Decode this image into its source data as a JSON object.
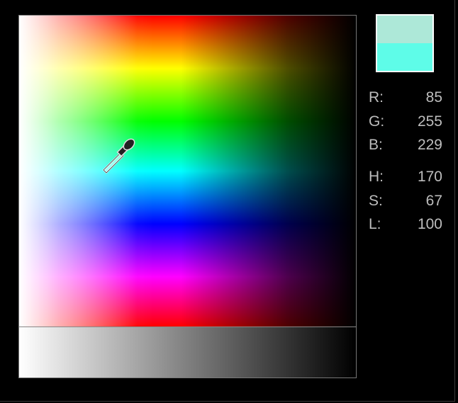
{
  "colors": {
    "previous": "#ade8d8",
    "current": "#5efce8"
  },
  "rgb": [
    {
      "label": "R:",
      "value": "85"
    },
    {
      "label": "G:",
      "value": "255"
    },
    {
      "label": "B:",
      "value": "229"
    }
  ],
  "hsl": [
    {
      "label": "H:",
      "value": "170"
    },
    {
      "label": "S:",
      "value": "67"
    },
    {
      "label": "L:",
      "value": "100"
    }
  ]
}
